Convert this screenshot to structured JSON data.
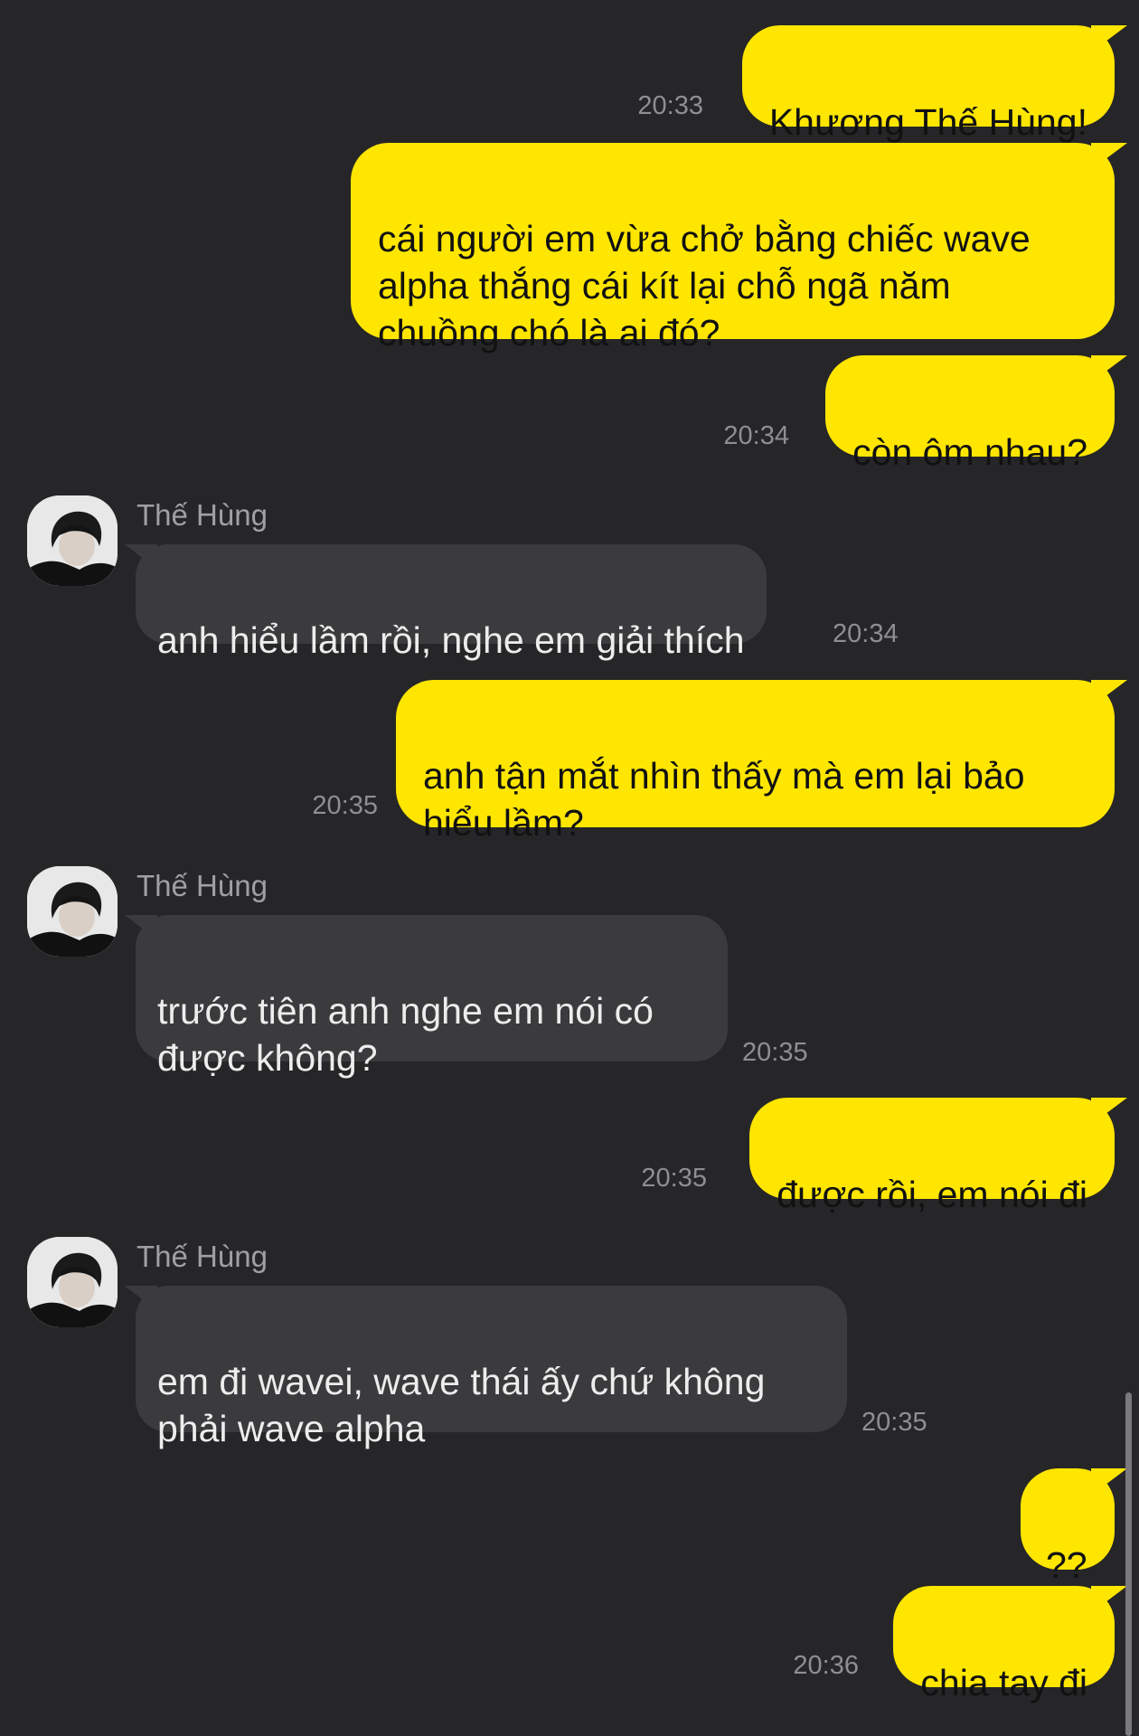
{
  "contact": {
    "name": "Thế Hùng"
  },
  "messages": [
    {
      "from": "me",
      "text": "Khương Thế Hùng!",
      "time": "20:33"
    },
    {
      "from": "me",
      "text": "cái người em vừa chở bằng chiếc wave\nalpha thắng cái kít lại chỗ ngã năm\nchuồng chó là ai đó?",
      "time": ""
    },
    {
      "from": "me",
      "text": "còn ôm nhau?",
      "time": "20:34"
    },
    {
      "from": "them",
      "text": "anh hiểu lầm rồi, nghe em giải thích",
      "time": "20:34"
    },
    {
      "from": "me",
      "text": "anh tận mắt nhìn thấy mà em lại bảo\nhiểu lầm?",
      "time": "20:35"
    },
    {
      "from": "them",
      "text": "trước tiên anh nghe em nói có\nđược không?",
      "time": "20:35"
    },
    {
      "from": "me",
      "text": "được rồi, em nói đi",
      "time": "20:35"
    },
    {
      "from": "them",
      "text": "em đi wavei, wave thái ấy chứ không\nphải wave alpha",
      "time": "20:35"
    },
    {
      "from": "me",
      "text": "??",
      "time": ""
    },
    {
      "from": "me",
      "text": "chia tay đi",
      "time": "20:36"
    }
  ],
  "colors": {
    "background": "#262628",
    "outgoing_bubble": "#FFE600",
    "incoming_bubble": "#3B3B3E",
    "timestamp": "#8E8E93"
  }
}
